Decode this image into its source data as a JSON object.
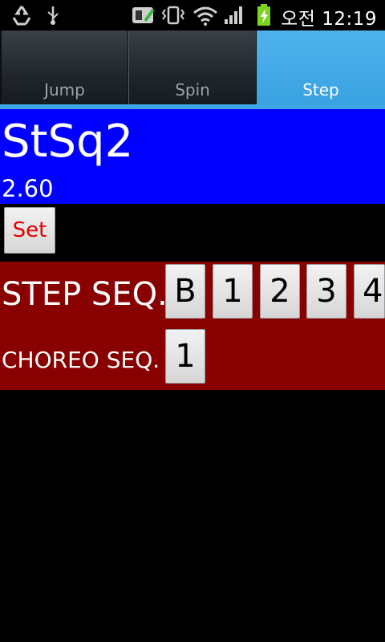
{
  "status_bar": {
    "time": "오전 12:19",
    "icons": [
      "recycle-icon",
      "usb-icon",
      "bug-icon",
      "vibrate-icon",
      "wifi-icon",
      "signal-icon",
      "battery-charging-icon"
    ]
  },
  "tabs": [
    {
      "label": "Jump",
      "active": false
    },
    {
      "label": "Spin",
      "active": false
    },
    {
      "label": "Step",
      "active": true
    }
  ],
  "element": {
    "name": "StSq2",
    "value": "2.60"
  },
  "set_button": "Set",
  "step_seq": {
    "label": "STEP SEQ.",
    "levels": [
      "B",
      "1",
      "2",
      "3",
      "4"
    ]
  },
  "choreo_seq": {
    "label": "CHOREO SEQ.",
    "levels": [
      "1"
    ]
  },
  "colors": {
    "header_bg": "#0000ff",
    "levels_bg": "#880000",
    "tab_active": "#3aa2e1",
    "set_text": "#e20000"
  }
}
